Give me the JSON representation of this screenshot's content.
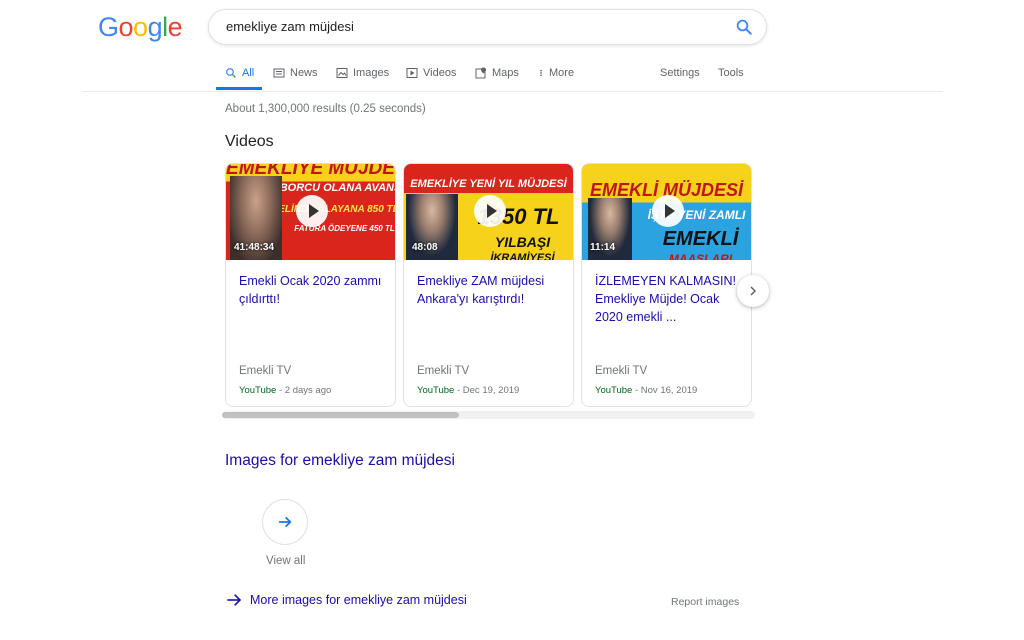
{
  "search": {
    "query": "emekliye zam müjdesi"
  },
  "logo": {
    "letters": [
      "G",
      "o",
      "o",
      "g",
      "l",
      "e"
    ],
    "colors": [
      "#4285f4",
      "#ea4335",
      "#fbbc05",
      "#4285f4",
      "#34a853",
      "#ea4335"
    ]
  },
  "tabs": {
    "all": "All",
    "news": "News",
    "images": "Images",
    "videos": "Videos",
    "maps": "Maps",
    "more": "More",
    "settings": "Settings",
    "tools": "Tools"
  },
  "results": {
    "stats": "About 1,300,000 results (0.25 seconds)"
  },
  "videos": {
    "heading": "Videos",
    "items": [
      {
        "title": "Emekli Ocak 2020 zammı çıldırttı!",
        "duration": "41:48:34",
        "channel": "Emekli TV",
        "source": "YouTube",
        "date": " - 2 days ago",
        "thumb_lines": [
          "EMEKLİYE MÜJDE",
          "BORCU OLANA AVANS",
          "ELİNDE ALAYANA 850 TL",
          "FATURA ÖDEYENE 450 TL"
        ]
      },
      {
        "title": "Emekliye ZAM müjdesi Ankara'yı karıştırdı!",
        "duration": "48:08",
        "channel": "Emekli TV",
        "source": "YouTube",
        "date": " - Dec 19, 2019",
        "thumb_lines": [
          "EMEKLİYE YENİ YIL MÜJDESİ",
          "1350 TL",
          "YILBAŞI",
          "İKRAMİYESİ"
        ]
      },
      {
        "title": "İZLEMEYEN KALMASIN! Emekliye Müjde! Ocak 2020 emekli ...",
        "duration": "11:14",
        "channel": "Emekli TV",
        "source": "YouTube",
        "date": " - Nov 16, 2019",
        "thumb_lines": [
          "EMEKLİ MÜJDESİ",
          "İŞTE YENİ ZAMLI",
          "EMEKLİ",
          "MAAŞLARI"
        ]
      }
    ]
  },
  "images": {
    "heading": "Images for emekliye zam müjdesi",
    "view_all": "View all",
    "more_link": "More images for emekliye zam müjdesi",
    "report": "Report images"
  }
}
